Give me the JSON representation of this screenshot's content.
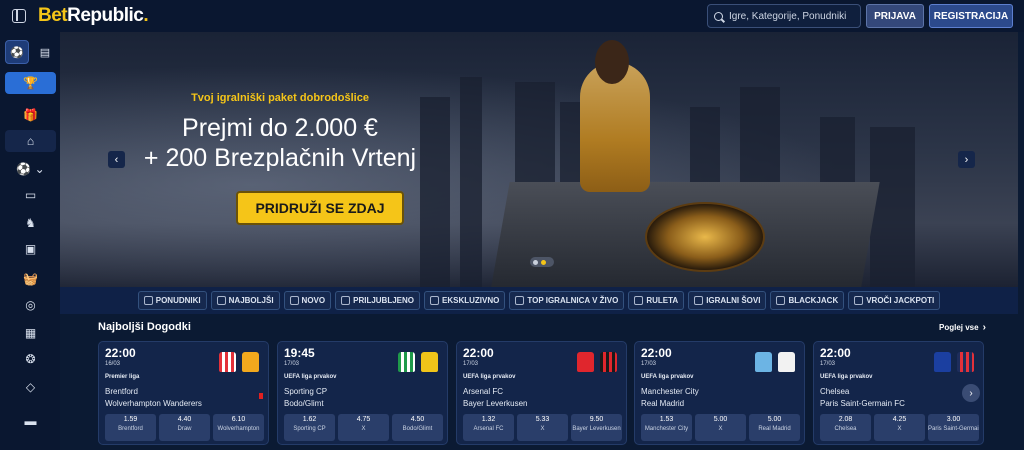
{
  "brand": {
    "logo_bet": "Bet",
    "logo_republic": "Republic",
    "logo_dot": "."
  },
  "header": {
    "search_placeholder": "Igre, Kategorije, Ponudniki",
    "login_label": "PRIJAVA",
    "register_label": "REGISTRACIJA"
  },
  "sidebar": {
    "tabs": [
      {
        "icon": "soccer-ball-icon"
      },
      {
        "icon": "betslip-icon"
      }
    ],
    "items": [
      {
        "icon": "trophy-icon",
        "glyph": "🏆"
      },
      {
        "icon": "gift-icon",
        "glyph": "🎁"
      },
      {
        "icon": "home-icon",
        "glyph": "⌂"
      },
      {
        "icon": "sports-icon",
        "glyph": "⚽ ⌄"
      },
      {
        "icon": "live-icon",
        "glyph": "▭"
      },
      {
        "icon": "horse-icon",
        "glyph": "♞"
      },
      {
        "icon": "slots-icon",
        "glyph": "▣"
      },
      {
        "icon": "basket-icon",
        "glyph": "🧺"
      },
      {
        "icon": "medal-icon",
        "glyph": "◎"
      },
      {
        "icon": "casino-icon",
        "glyph": "▦"
      },
      {
        "icon": "promo-icon",
        "glyph": "❂"
      },
      {
        "icon": "diamond-icon",
        "glyph": "◇"
      },
      {
        "icon": "language-flag-icon",
        "glyph": "▬"
      }
    ]
  },
  "banner": {
    "subtitle": "Tvoj igralniški paket dobrodošlice",
    "line1": "Prejmi do 2.000 €",
    "line2": "+ 200 Brezplačnih Vrtenj",
    "cta": "PRIDRUŽI SE ZDAJ",
    "prev": "‹",
    "next": "›"
  },
  "categories": [
    "PONUDNIKI",
    "NAJBOLJŠI",
    "NOVO",
    "PRILJUBLJENO",
    "EKSKLUZIVNO",
    "TOP IGRALNICA V ŽIVO",
    "RULETA",
    "IGRALNI ŠOVI",
    "BLACKJACK",
    "VROČI JACKPOTI"
  ],
  "events": {
    "title": "Najboljši Dogodki",
    "see_all": "Poglej vse",
    "see_all_arrow": "›",
    "next": "›",
    "matches": [
      {
        "time": "22:00",
        "date": "16/03",
        "league": "Premier liga",
        "home": "Brentford",
        "away": "Wolverhampton Wanderers",
        "odds": [
          {
            "v": "1.59",
            "l": "Brentford"
          },
          {
            "v": "4.40",
            "l": "Draw"
          },
          {
            "v": "6.10",
            "l": "Wolverhampton"
          }
        ],
        "home_color": "#e3313a",
        "home_stripe": "#ffffff",
        "away_color": "#f2a81d",
        "away_stripe": "#f2a81d"
      },
      {
        "time": "19:45",
        "date": "17/03",
        "league": "UEFA liga prvakov",
        "home": "Sporting CP",
        "away": "Bodo/Glimt",
        "odds": [
          {
            "v": "1.62",
            "l": "Sporting CP"
          },
          {
            "v": "4.75",
            "l": "X"
          },
          {
            "v": "4.50",
            "l": "Bodo/Glimt"
          }
        ],
        "home_color": "#1f9a4a",
        "home_stripe": "#ffffff",
        "away_color": "#f0c419",
        "away_stripe": "#f0c419"
      },
      {
        "time": "22:00",
        "date": "17/03",
        "league": "UEFA liga prvakov",
        "home": "Arsenal FC",
        "away": "Bayer Leverkusen",
        "odds": [
          {
            "v": "1.32",
            "l": "Arsenal FC"
          },
          {
            "v": "5.33",
            "l": "X"
          },
          {
            "v": "9.50",
            "l": "Bayer Leverkusen"
          }
        ],
        "home_color": "#e0262d",
        "home_stripe": "#e0262d",
        "away_color": "#1a1a1a",
        "away_stripe": "#e0262d"
      },
      {
        "time": "22:00",
        "date": "17/03",
        "league": "UEFA liga prvakov",
        "home": "Manchester City",
        "away": "Real Madrid",
        "odds": [
          {
            "v": "1.53",
            "l": "Manchester City"
          },
          {
            "v": "5.00",
            "l": "X"
          },
          {
            "v": "5.00",
            "l": "Real Madrid"
          }
        ],
        "home_color": "#6cb4e4",
        "home_stripe": "#6cb4e4",
        "away_color": "#f2f2f2",
        "away_stripe": "#f2f2f2"
      },
      {
        "time": "22:00",
        "date": "17/03",
        "league": "UEFA liga prvakov",
        "home": "Chelsea",
        "away": "Paris Saint-Germain FC",
        "odds": [
          {
            "v": "2.08",
            "l": "Chelsea"
          },
          {
            "v": "4.25",
            "l": "X"
          },
          {
            "v": "3.00",
            "l": "Paris Saint-Germain"
          }
        ],
        "home_color": "#1b3fa0",
        "home_stripe": "#1b3fa0",
        "away_color": "#1e2d5c",
        "away_stripe": "#e3313a"
      }
    ]
  }
}
